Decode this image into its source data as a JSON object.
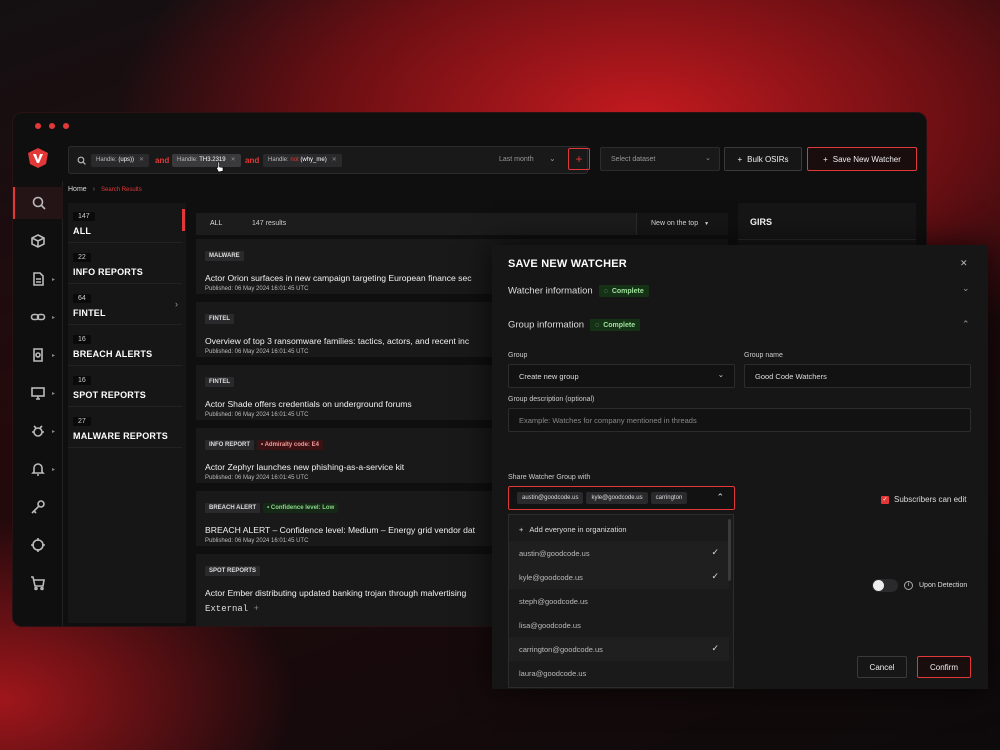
{
  "search": {
    "chips": [
      {
        "key": "Handle:",
        "val": "(ups))"
      },
      {
        "key": "Handle:",
        "val": "TH3.2319"
      },
      {
        "key": "Handle:",
        "neg": "not",
        "val": "(why_me)"
      }
    ],
    "and": "and",
    "period": "Last month"
  },
  "toolbar": {
    "dataset_placeholder": "Select dataset",
    "bulk": "Bulk OSIRs",
    "save": "Save New Watcher",
    "plus": "+"
  },
  "breadcrumb": {
    "home": "Home",
    "current": "Search Results"
  },
  "categories": [
    {
      "count": "147",
      "name": "ALL"
    },
    {
      "count": "22",
      "name": "INFO REPORTS"
    },
    {
      "count": "64",
      "name": "FINTEL"
    },
    {
      "count": "16",
      "name": "BREACH ALERTS"
    },
    {
      "count": "16",
      "name": "SPOT REPORTS"
    },
    {
      "count": "27",
      "name": "MALWARE REPORTS"
    }
  ],
  "list": {
    "tab": "ALL",
    "count": "147 results",
    "sort": "New on the top"
  },
  "results": [
    {
      "tags": [
        "MALWARE"
      ],
      "title": "Actor Orion surfaces in new campaign targeting European finance sec",
      "date": "Published: 06 May 2024 16:01:45 UTC"
    },
    {
      "tags": [
        "FINTEL"
      ],
      "title": "Overview of top 3 ransomware families: tactics, actors, and recent inc",
      "date": "Published: 06 May 2024 16:01:45 UTC"
    },
    {
      "tags": [
        "FINTEL"
      ],
      "title": "Actor Shade offers credentials on underground forums",
      "date": "Published: 06 May 2024 16:01:45 UTC"
    },
    {
      "tags": [
        "INFO REPORT"
      ],
      "extra": "Admiralty code: E4",
      "title": "Actor Zephyr launches new phishing-as-a-service kit",
      "date": "Published: 06 May 2024 16:01:45 UTC"
    },
    {
      "tags": [
        "BREACH ALERT"
      ],
      "extra": "Confidence level: Low",
      "title": "BREACH ALERT – Confidence level: Medium – Energy grid vendor dat",
      "date": "Published: 06 May 2024 16:01:45 UTC"
    },
    {
      "tags": [
        "SPOT REPORTS"
      ],
      "title": "Actor Ember distributing updated banking trojan through malvertising",
      "date": "External"
    }
  ],
  "girs": {
    "title": "GIRS"
  },
  "modal": {
    "title": "SAVE NEW WATCHER",
    "sec1": "Watcher information",
    "sec2": "Group information",
    "complete": "Complete",
    "group_label": "Group",
    "group_value": "Create new group",
    "gname_label": "Group name",
    "gname_value": "Good Code Watchers",
    "desc_label": "Group description (optional)",
    "desc_placeholder": "Example: Watches for company mentioned in threads",
    "share_label": "Share Watcher Group with",
    "share_chips": [
      "austin@goodcode.us",
      "kyle@goodcode.us",
      "carrington"
    ],
    "subscribers": "Subscribers can edit",
    "upon": "Upon Detection",
    "cancel": "Cancel",
    "confirm": "Confirm",
    "dropdown": [
      {
        "label": "Add everyone in organization",
        "add": true
      },
      {
        "label": "austin@goodcode.us",
        "checked": true
      },
      {
        "label": "kyle@goodcode.us",
        "checked": true
      },
      {
        "label": "steph@goodcode.us"
      },
      {
        "label": "lisa@goodcode.us"
      },
      {
        "label": "carrington@goodcode.us",
        "checked": true
      },
      {
        "label": "laura@goodcode.us"
      }
    ]
  },
  "colors": {
    "accent": "#e23838",
    "complete": "#9fe09f"
  }
}
